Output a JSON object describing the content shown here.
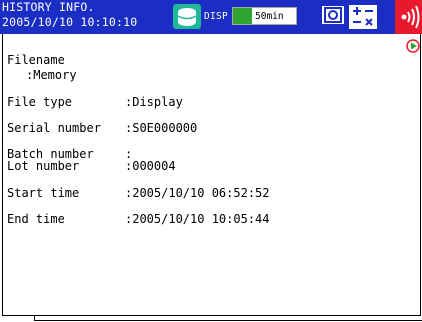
{
  "header": {
    "title_line1": "HISTORY INFO.",
    "title_line2": "2005/10/10 10:10:10",
    "disp_label": "DISP",
    "time_label": "50min",
    "time_progress": 0.3,
    "icons": [
      "history-icon",
      "snapshot-icon",
      "math-calc-icon",
      "alarm-icon",
      "play-icon"
    ],
    "colors": {
      "header_bg": "#1a2ec4",
      "progress_fill": "#2fa52f",
      "alarm": "#e8192c"
    }
  },
  "fields": {
    "filename_label": "Filename",
    "filename_value": ":Memory",
    "file_type_label": "File type",
    "file_type_value": ":Display",
    "serial_label": "Serial number",
    "serial_value": ":S0E000000",
    "batch_label": "Batch number",
    "batch_value": ":",
    "lot_label": "Lot number",
    "lot_value": ":000004",
    "start_label": "Start time",
    "start_value": ":2005/10/10 06:52:52",
    "end_label": "End time",
    "end_value": ":2005/10/10 10:05:44"
  }
}
